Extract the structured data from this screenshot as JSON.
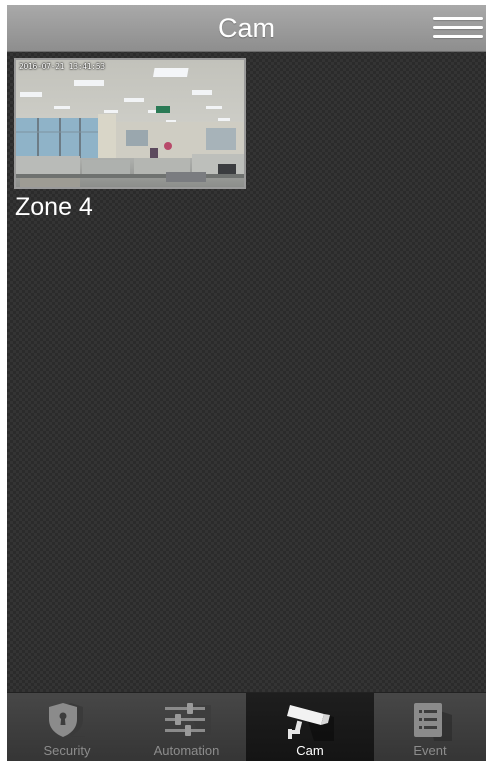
{
  "header": {
    "title": "Cam"
  },
  "cameras": [
    {
      "timestamp": "2016-07-21 13:41:53",
      "label": "Zone 4"
    }
  ],
  "tabs": [
    {
      "label": "Security",
      "icon": "shield-lock-icon",
      "active": false
    },
    {
      "label": "Automation",
      "icon": "sliders-icon",
      "active": false
    },
    {
      "label": "Cam",
      "icon": "security-camera-icon",
      "active": true
    },
    {
      "label": "Event",
      "icon": "event-list-icon",
      "active": false
    }
  ],
  "colors": {
    "header_bg": "#9c9c9c",
    "body_bg": "#2b2b2b",
    "tabbar_bg": "#3e3e3e",
    "active_tab_bg": "#181818",
    "text": "#ffffff",
    "inactive_label": "#8c8c8c"
  }
}
